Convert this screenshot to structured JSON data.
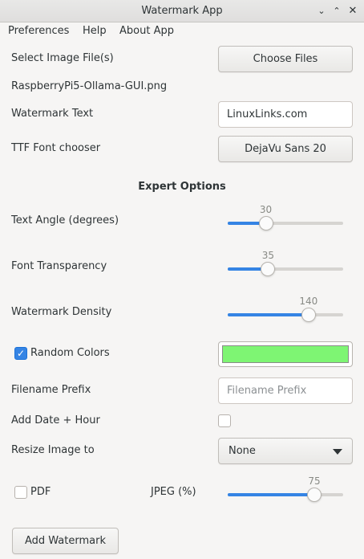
{
  "window": {
    "title": "Watermark App",
    "controls": [
      "chevron-down-icon",
      "chevron-up-icon",
      "close-icon"
    ]
  },
  "menubar": {
    "items": [
      "Preferences",
      "Help",
      "About App"
    ]
  },
  "image": {
    "label": "Select Image File(s)",
    "button": "Choose Files",
    "filename": "RaspberryPi5-Ollama-GUI.png"
  },
  "watermark_text": {
    "label": "Watermark Text",
    "value": "LinuxLinks.com"
  },
  "font": {
    "label": "TTF Font chooser",
    "value": "DejaVu Sans 20"
  },
  "expert": {
    "title": "Expert Options",
    "angle": {
      "label": "Text Angle (degrees)",
      "value": "30",
      "fraction": 0.33
    },
    "transparency": {
      "label": "Font Transparency",
      "value": "35",
      "fraction": 0.35
    },
    "density": {
      "label": "Watermark Density",
      "value": "140",
      "fraction": 0.7
    }
  },
  "random_colors": {
    "label": "Random Colors",
    "checked": true,
    "color": "#7ef573"
  },
  "prefix": {
    "label": "Filename Prefix",
    "placeholder": "Filename Prefix"
  },
  "date_hour": {
    "label": "Add Date + Hour",
    "checked": false
  },
  "resize": {
    "label": "Resize Image to",
    "value": "None"
  },
  "output": {
    "pdf_label": "PDF",
    "pdf_checked": false,
    "jpeg_label": "JPEG (%)",
    "jpeg_value": "75",
    "jpeg_fraction": 0.75
  },
  "actions": {
    "add": "Add Watermark"
  },
  "colors": {
    "accent": "#3584e4",
    "background": "#f6f5f4"
  }
}
